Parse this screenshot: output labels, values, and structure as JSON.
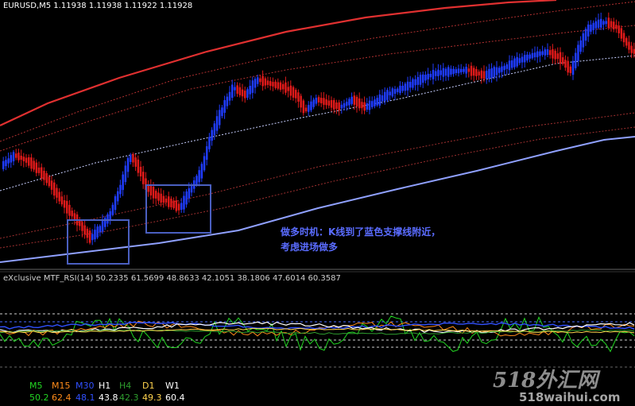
{
  "header": {
    "symbol_quote": "EURUSD,M5  1.11938 1.11938 1.11922 1.11928"
  },
  "annotation": {
    "line1": "做多时机：K线到了蓝色支撑线附近，",
    "line2": "考虑进场做多"
  },
  "subwindow": {
    "title": "eXclusive MTF_RSI(14) 50.2335 61.5699 48.8633 42.1051 38.1806 47.6014 60.3587"
  },
  "rsi_table": {
    "labels": [
      "M5",
      "M15",
      "M30",
      "H1",
      "H4",
      "D1",
      "W1"
    ],
    "values": [
      "50.2",
      "62.4",
      "48.1",
      "43.8",
      "42.3",
      "49.3",
      "60.4"
    ],
    "colors": [
      "#22d622",
      "#ff8c1a",
      "#3050ff",
      "#ffffff",
      "#2e9e2e",
      "#ffd34d",
      "#ffffff"
    ]
  },
  "watermark": {
    "line1": "518外汇网",
    "line2": "518waihui.com"
  },
  "colors": {
    "bull": "#1f3cff",
    "bear": "#e01a1a",
    "support_line": "#8fa0ff",
    "upper_band": "#e03030",
    "mid_line": "#c8cfff",
    "highlight_box": "#4a5fc0"
  },
  "chart_data": [
    {
      "type": "candlestick",
      "title": "EURUSD,M5",
      "note": "5-minute candlestick chart with moving-average envelope bands"
    },
    {
      "type": "line",
      "title": "eXclusive MTF_RSI(14)",
      "series": [
        {
          "name": "M5",
          "last": 50.2335
        },
        {
          "name": "M15",
          "last": 61.5699
        },
        {
          "name": "M30",
          "last": 48.8633
        },
        {
          "name": "H1",
          "last": 42.1051
        },
        {
          "name": "H4",
          "last": 38.1806
        },
        {
          "name": "D1",
          "last": 47.6014
        },
        {
          "name": "W1",
          "last": 60.3587
        }
      ]
    }
  ]
}
